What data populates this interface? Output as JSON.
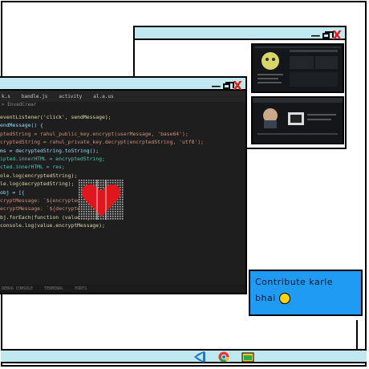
{
  "window_controls": {
    "minimize": "—",
    "maximize": "☐",
    "close": "X"
  },
  "editor": {
    "tabs": [
      "k.s",
      "bandle.js",
      "activity",
      "al.a.us"
    ],
    "breadcrumb": "> EnvadCrear",
    "code_lines": [
      {
        "text": "eventListener('click', sendMessage);",
        "color": "#dcdcaa"
      },
      {
        "text": "endMessage() {",
        "color": "#9cdcfe"
      },
      {
        "text": "ptedString = rahul_public_key.encrypt(userMessage, 'base64');",
        "color": "#ce9178"
      },
      {
        "text": "cryptedString = rahul_private_key.decrypt(encrptedString, 'utf8');",
        "color": "#ce9178"
      },
      {
        "text": "ms = decryptedString.toString();",
        "color": "#9cdcfe"
      },
      {
        "text": "ipted.innerHTML = encryptedString;",
        "color": "#4ec9b0"
      },
      {
        "text": "cted.innerHTML = res;",
        "color": "#4ec9b0"
      },
      {
        "text": "ole.log(encryptedString);",
        "color": "#dcdcaa"
      },
      {
        "text": "le.log(decryptedString);",
        "color": "#dcdcaa"
      },
      {
        "text": "",
        "color": "#9cdcfe"
      },
      {
        "text": "obj = [{",
        "color": "#9cdcfe"
      },
      {
        "text": "cryptMessage: `${encryptedString}",
        "color": "#ce9178"
      },
      {
        "text": "",
        "color": "#9cdcfe"
      },
      {
        "text": "ecryptMessage: `${decryptedString}`",
        "color": "#ce9178"
      },
      {
        "text": "",
        "color": "#9cdcfe"
      },
      {
        "text": "",
        "color": "#9cdcfe"
      },
      {
        "text": "bj.forEach(function (value) {",
        "color": "#dcdcaa"
      },
      {
        "text": "console.log(value.encryptMessage);",
        "color": "#dcdcaa"
      }
    ],
    "status": [
      "DEBUG CONSOLE",
      "TERMINAL",
      "PORTS"
    ]
  },
  "note": {
    "line1": "Contribute karle",
    "line2": "bhai"
  },
  "taskbar": {
    "icons": [
      "vscode-icon",
      "chrome-icon",
      "folder-icon"
    ]
  },
  "colors": {
    "titlebar": "#bfe8f0",
    "note_bg": "#1f9bf3",
    "close": "#e21b1b"
  }
}
